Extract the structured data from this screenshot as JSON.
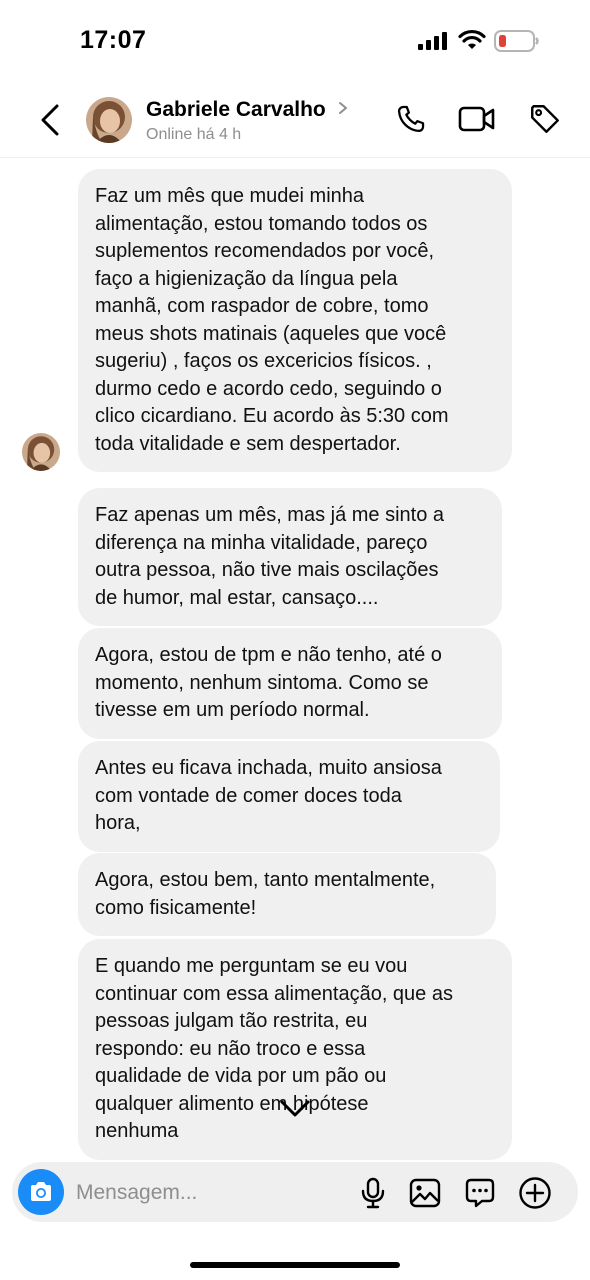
{
  "status_bar": {
    "time": "17:07",
    "icons": [
      "cellular-signal-icon",
      "wifi-icon",
      "battery-low-icon"
    ],
    "battery_color": "#e0423a"
  },
  "header": {
    "back_icon": "chevron-left-icon",
    "contact_name": "Gabriele Carvalho",
    "contact_status": "Online há 4 h",
    "actions": [
      "phone-icon",
      "video-camera-icon",
      "tag-icon"
    ]
  },
  "messages": [
    {
      "text": "Faz um mês que mudei minha\nalimentação, estou tomando todos os\nsuplementos recomendados por você,\nfaço a higienização da  língua pela\nmanhã, com raspador de cobre, tomo\nmeus shots matinais (aqueles que você\nsugeriu) , faços os excericios físicos. ,\ndurmo cedo e acordo cedo, seguindo o\nclico cicardiano. Eu acordo às 5:30 com\ntoda vitalidade e sem despertador."
    },
    {
      "text": "Faz apenas um mês, mas já me  sinto a\ndiferença na minha vitalidade, pareço\noutra pessoa, não tive mais oscilações\nde humor, mal estar, cansaço...."
    },
    {
      "text": "Agora, estou de tpm e não tenho, até o\nmomento, nenhum sintoma. Como se\ntivesse em um período normal."
    },
    {
      "text": "Antes eu ficava inchada, muito ansiosa\ncom vontade de comer doces toda\nhora,"
    },
    {
      "text": "Agora, estou bem, tanto mentalmente,\ncomo fisicamente!"
    },
    {
      "text": "E quando me perguntam se eu vou\ncontinuar com essa alimentação, que as\npessoas julgam tão restrita, eu\nrespondo: eu não troco e essa\nqualidade de vida por um pão ou\nqualquer alimento em hipótese\nnenhuma"
    }
  ],
  "composer": {
    "placeholder": "Mensagem...",
    "icons": [
      "camera-icon",
      "microphone-icon",
      "gallery-icon",
      "sticker-icon",
      "plus-circle-icon"
    ],
    "accent": "#1a8cf7"
  },
  "scroll_icon": "chevron-down-icon"
}
